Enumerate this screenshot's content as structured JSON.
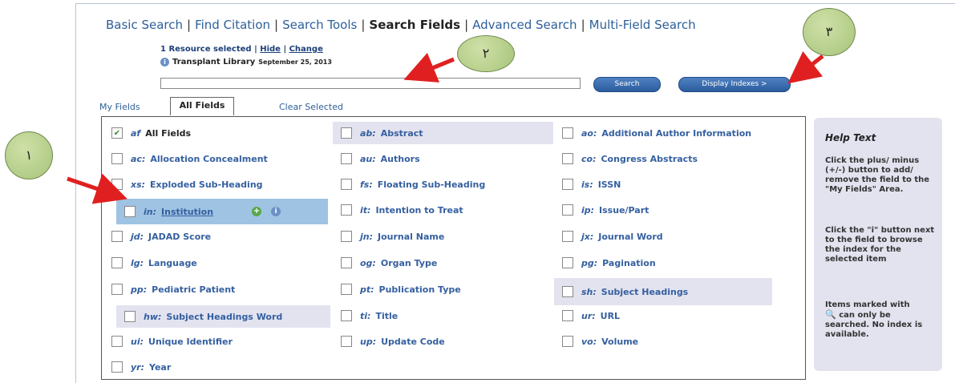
{
  "nav": {
    "items": [
      "Basic Search",
      "Find Citation",
      "Search Tools",
      "Search Fields",
      "Advanced Search",
      "Multi-Field Search"
    ],
    "active": "Search Fields",
    "separator": "|"
  },
  "resource": {
    "selected_text": "1 Resource selected",
    "sep": "|",
    "hide": "Hide",
    "change": "Change",
    "library_name": "Transplant Library",
    "library_date": "September 25, 2013"
  },
  "search": {
    "value": "",
    "search_button": "Search",
    "display_indexes_button": "Display Indexes >"
  },
  "tabs": {
    "my_fields": "My Fields",
    "all_fields": "All Fields",
    "clear_selected": "Clear Selected"
  },
  "fields": [
    {
      "code": "af",
      "label": "All Fields",
      "checked": true
    },
    {
      "code": "ab:",
      "label": "Abstract"
    },
    {
      "code": "ao:",
      "label": "Additional Author Information"
    },
    {
      "code": "ac:",
      "label": "Allocation Concealment"
    },
    {
      "code": "au:",
      "label": "Authors"
    },
    {
      "code": "co:",
      "label": "Congress Abstracts"
    },
    {
      "code": "xs:",
      "label": "Exploded Sub-Heading"
    },
    {
      "code": "fs:",
      "label": "Floating Sub-Heading"
    },
    {
      "code": "is:",
      "label": "ISSN"
    },
    {
      "code": "in:",
      "label": "Institution"
    },
    {
      "code": "it:",
      "label": "Intention to Treat"
    },
    {
      "code": "ip:",
      "label": "Issue/Part"
    },
    {
      "code": "jd:",
      "label": "JADAD Score"
    },
    {
      "code": "jn:",
      "label": "Journal Name"
    },
    {
      "code": "jx:",
      "label": "Journal Word"
    },
    {
      "code": "lg:",
      "label": "Language"
    },
    {
      "code": "og:",
      "label": "Organ Type"
    },
    {
      "code": "pg:",
      "label": "Pagination"
    },
    {
      "code": "pp:",
      "label": "Pediatric Patient"
    },
    {
      "code": "pt:",
      "label": "Publication Type"
    },
    {
      "code": "sh:",
      "label": "Subject Headings"
    },
    {
      "code": "hw:",
      "label": "Subject Headings Word"
    },
    {
      "code": "ti:",
      "label": "Title"
    },
    {
      "code": "ur:",
      "label": "URL"
    },
    {
      "code": "ui:",
      "label": "Unique Identifier"
    },
    {
      "code": "up:",
      "label": "Update Code"
    },
    {
      "code": "vo:",
      "label": "Volume"
    },
    {
      "code": "yr:",
      "label": "Year"
    }
  ],
  "help": {
    "title": "Help Text",
    "p1": "Click the plus/ minus (+/-) button to add/ remove the field to the \"My Fields\" Area.",
    "p2": "Click the \"i\" button next to the field to browse the index for the selected item",
    "p3_a": "Items marked with",
    "p3_b": "can only be searched. No index is available."
  },
  "annotations": {
    "one": "١",
    "two": "٢",
    "three": "٣"
  },
  "colors": {
    "link": "#2d5f9a",
    "button": "#2b5c9e",
    "shaded_row": "#e3e3f0",
    "selected_row": "#9fc3e2",
    "arrow": "#e02020",
    "badge": "#a7c47a"
  }
}
